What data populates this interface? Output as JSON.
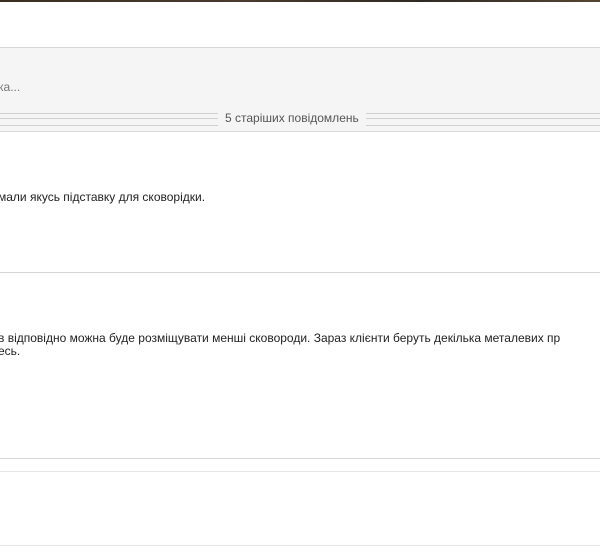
{
  "thread": {
    "collapsed_snippet": "ка...",
    "older_messages_label": "5 старіших повідомлень",
    "messages": [
      {
        "line1": "мали якусь підставку для сковорідки."
      },
      {
        "line1": " в відповідно можна буде розміщувати менші сковороди. Зараз клієнти беруть декілька металевих пр",
        "line2": "есь."
      }
    ]
  },
  "colors": {
    "background": "#ffffff",
    "collapsed_row_bg": "#f5f5f5",
    "divider": "#d5d5d5"
  }
}
